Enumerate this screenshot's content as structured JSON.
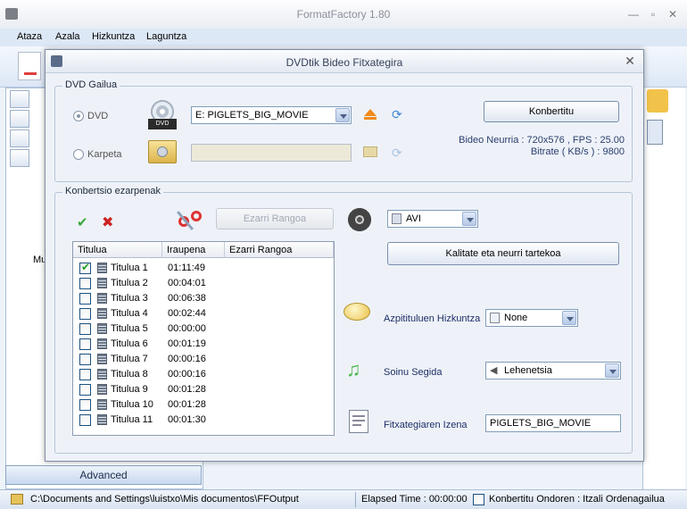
{
  "app": {
    "title": "FormatFactory 1.80",
    "menu": [
      "Ataza",
      "Azala",
      "Hizkuntza",
      "Laguntza"
    ],
    "left_panel_text": "Mu",
    "advanced_label": "Advanced"
  },
  "statusbar": {
    "path": "C:\\Documents and Settings\\luistxo\\Mis documentos\\FFOutput",
    "elapsed": "Elapsed Time : 00:00:00",
    "after_convert": "Konbertitu Ondoren : Itzali Ordenagailua"
  },
  "dialog": {
    "title": "DVDtik Bideo Fitxategira",
    "dvd_group": {
      "label": "DVD Gailua",
      "dvd_option": "DVD",
      "folder_option": "Karpeta",
      "drive_value": "E:  PIGLETS_BIG_MOVIE",
      "folder_value": "",
      "convert_button": "Konbertitu",
      "video_info": "Bideo Neurria : 720x576 , FPS : 25.00",
      "bitrate_info": "Bitrate ( KB/s ) : 9800"
    },
    "settings_group": {
      "label": "Konbertsio ezarpenak",
      "set_range_button": "Ezarri Rangoa",
      "format_value": "AVI",
      "quality_button": "Kalitate eta neurri tartekoa",
      "columns": [
        "Titulua",
        "Iraupena",
        "Ezarri Rangoa"
      ],
      "rows": [
        {
          "name": "Titulua 1",
          "duration": "01:11:49",
          "checked": true
        },
        {
          "name": "Titulua 2",
          "duration": "00:04:01",
          "checked": false
        },
        {
          "name": "Titulua 3",
          "duration": "00:06:38",
          "checked": false
        },
        {
          "name": "Titulua 4",
          "duration": "00:02:44",
          "checked": false
        },
        {
          "name": "Titulua 5",
          "duration": "00:00:00",
          "checked": false
        },
        {
          "name": "Titulua 6",
          "duration": "00:01:19",
          "checked": false
        },
        {
          "name": "Titulua 7",
          "duration": "00:00:16",
          "checked": false
        },
        {
          "name": "Titulua 8",
          "duration": "00:00:16",
          "checked": false
        },
        {
          "name": "Titulua 9",
          "duration": "00:01:28",
          "checked": false
        },
        {
          "name": "Titulua 10",
          "duration": "00:01:28",
          "checked": false
        },
        {
          "name": "Titulua 11",
          "duration": "00:01:30",
          "checked": false
        }
      ],
      "subtitle_label": "Azpitituluen Hizkuntza",
      "subtitle_value": "None",
      "audio_label": "Soinu Segida",
      "audio_value": "Lehenetsia",
      "filename_label": "Fitxategiaren Izena",
      "filename_value": "PIGLETS_BIG_MOVIE"
    }
  }
}
